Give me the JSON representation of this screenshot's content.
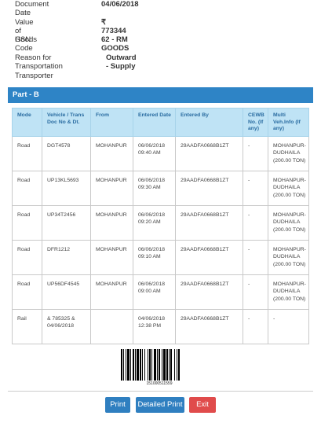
{
  "info": {
    "document_date_label": "Document Date",
    "document_date_value": "04/06/2018",
    "value_goods_label": "Value of Goods",
    "value_goods_value": "₹ 773344",
    "hsn_label": "HSN Code",
    "hsn_value": "62 - RM GOODS",
    "reason_label": "Reason for Transportation",
    "reason_value": "Outward - Supply",
    "transporter_label": "Transporter"
  },
  "part_b": {
    "title": "Part - B",
    "headers": {
      "mode": "Mode",
      "vehicle": "Vehicle / Trans Doc No & Dt.",
      "from": "From",
      "entered_date": "Entered Date",
      "entered_by": "Entered By",
      "cewb": "CEWB No. (If any)",
      "multi": "Multi Veh.Info (If any)"
    },
    "rows": [
      {
        "mode": "Road",
        "vehicle": "DGT4578",
        "from": "MOHANPUR",
        "date": "06/06/2018 09:40 AM",
        "by": "29AADFA0668B1ZT",
        "cewb": "-",
        "multi": "MOHANPUR-DUDHAILA (200.00 TON)"
      },
      {
        "mode": "Road",
        "vehicle": "UP13KL5693",
        "from": "MOHANPUR",
        "date": "06/06/2018 09:30 AM",
        "by": "29AADFA0668B1ZT",
        "cewb": "-",
        "multi": "MOHANPUR-DUDHAILA (200.00 TON)"
      },
      {
        "mode": "Road",
        "vehicle": "UP34T2456",
        "from": "MOHANPUR",
        "date": "06/06/2018 09:20 AM",
        "by": "29AADFA0668B1ZT",
        "cewb": "-",
        "multi": "MOHANPUR-DUDHAILA (200.00 TON)"
      },
      {
        "mode": "Road",
        "vehicle": "DFR1212",
        "from": "MOHANPUR",
        "date": "06/06/2018 09:10 AM",
        "by": "29AADFA0668B1ZT",
        "cewb": "-",
        "multi": "MOHANPUR-DUDHAILA (200.00 TON)"
      },
      {
        "mode": "Road",
        "vehicle": "UP56DF4545",
        "from": "MOHANPUR",
        "date": "06/06/2018 09:00 AM",
        "by": "29AADFA0668B1ZT",
        "cewb": "-",
        "multi": "MOHANPUR-DUDHAILA (200.00 TON)"
      },
      {
        "mode": "Rail",
        "vehicle": "& 785325 & 04/06/2018",
        "from": "",
        "date": "04/06/2018 12:38 PM",
        "by": "29AADFA0668B1ZT",
        "cewb": "-",
        "multi": "-"
      }
    ]
  },
  "barcode": {
    "number": "151000511559"
  },
  "buttons": {
    "print": "Print",
    "detailed_print": "Detailed Print",
    "exit": "Exit"
  },
  "colors": {
    "header_blue": "#2e84c6",
    "table_header_bg": "#bfe3f5",
    "button_blue": "#2f7fc0",
    "button_red": "#e04b4b"
  }
}
